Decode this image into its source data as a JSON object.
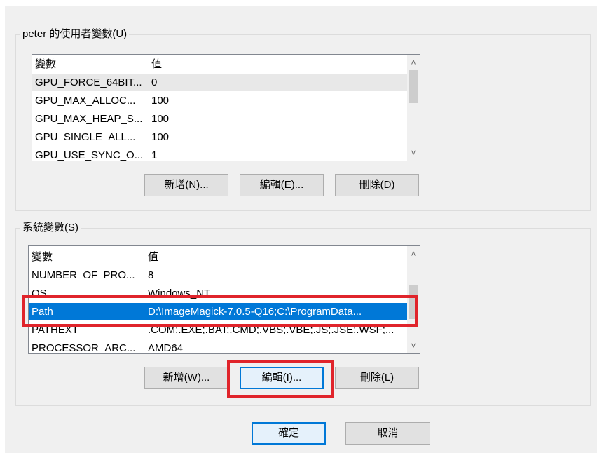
{
  "user_vars": {
    "title": "peter 的使用者變數(U)",
    "col_var": "變數",
    "col_val": "值",
    "rows": [
      {
        "name": "GPU_FORCE_64BIT...",
        "value": "0"
      },
      {
        "name": "GPU_MAX_ALLOC...",
        "value": "100"
      },
      {
        "name": "GPU_MAX_HEAP_S...",
        "value": "100"
      },
      {
        "name": "GPU_SINGLE_ALL...",
        "value": "100"
      },
      {
        "name": "GPU_USE_SYNC_O...",
        "value": "1"
      }
    ],
    "btn_new": "新增(N)...",
    "btn_edit": "編輯(E)...",
    "btn_delete": "刪除(D)"
  },
  "system_vars": {
    "title": "系統變數(S)",
    "col_var": "變數",
    "col_val": "值",
    "rows": [
      {
        "name": "NUMBER_OF_PRO...",
        "value": "8"
      },
      {
        "name": "OS",
        "value": "Windows_NT"
      },
      {
        "name": "Path",
        "value": "D:\\ImageMagick-7.0.5-Q16;C:\\ProgramData..."
      },
      {
        "name": "PATHEXT",
        "value": ".COM;.EXE;.BAT;.CMD;.VBS;.VBE;.JS;.JSE;.WSF;..."
      },
      {
        "name": "PROCESSOR_ARC...",
        "value": "AMD64"
      }
    ],
    "btn_new": "新增(W)...",
    "btn_edit": "編輯(I)...",
    "btn_delete": "刪除(L)"
  },
  "footer": {
    "ok": "確定",
    "cancel": "取消"
  },
  "colors": {
    "selection": "#0078d7",
    "highlight_box": "#e0242b"
  },
  "icons": {
    "scroll_up": "chevron-up-icon",
    "scroll_down": "chevron-down-icon"
  }
}
